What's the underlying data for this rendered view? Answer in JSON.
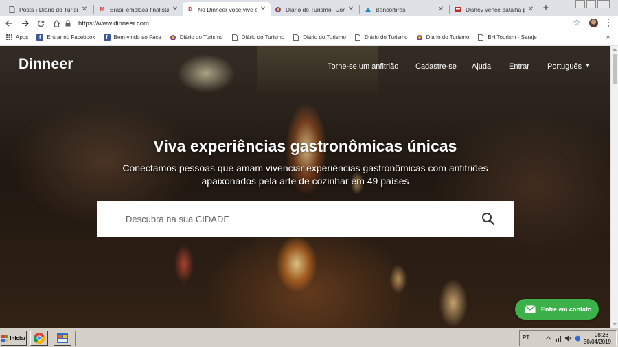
{
  "browser": {
    "tabs": [
      {
        "title": "Posts ‹ Diário do Turismo",
        "favicon": "page-icon",
        "active": false
      },
      {
        "title": "Brasil emplaca finalista e",
        "favicon": "gmail-icon",
        "active": false
      },
      {
        "title": "No Dinneer você vive ex",
        "favicon": "dinneer-icon",
        "active": true
      },
      {
        "title": "Diário do Turismo - Jorn",
        "favicon": "diario-icon",
        "active": false
      },
      {
        "title": "Bancorbrás",
        "favicon": "bancorbras-icon",
        "active": false
      },
      {
        "title": "Disney vence batalha pe",
        "favicon": "news-icon",
        "active": false
      }
    ],
    "new_tab_label": "+",
    "url": "https://www.dinneer.com",
    "bookmarks": [
      {
        "label": "Apps",
        "icon": "apps-grid-icon"
      },
      {
        "label": "Entrar no Facebook",
        "icon": "facebook-icon"
      },
      {
        "label": "Bem-vindo ao Face",
        "icon": "facebook-icon"
      },
      {
        "label": "Diário do Turismo",
        "icon": "diario-icon"
      },
      {
        "label": "Diário do Turismo",
        "icon": "page-icon"
      },
      {
        "label": "Diário do Turismo",
        "icon": "page-icon"
      },
      {
        "label": "Diário do Turismo",
        "icon": "page-icon"
      },
      {
        "label": "Diário do Turismo",
        "icon": "diario-icon"
      },
      {
        "label": "BH Tourism - Saraje",
        "icon": "page-icon"
      }
    ],
    "bookmarks_more": "»"
  },
  "site": {
    "brand": "Dinneer",
    "nav": {
      "host": "Torne-se um anfitrião",
      "signup": "Cadastre-se",
      "help": "Ajuda",
      "login": "Entrar",
      "language": "Português"
    },
    "hero": {
      "title": "Viva experiências gastronômicas únicas",
      "subtitle": "Conectamos pessoas que amam vivenciar experiências gastronômicas com anfitriões apaixonados pela arte de cozinhar em 49 países"
    },
    "search": {
      "placeholder": "Descubra na sua CIDADE"
    },
    "contact_button": "Entre em contato",
    "colors": {
      "contact_green": "#3cb14a"
    }
  },
  "taskbar": {
    "start_label": "Iniciar",
    "language": "PT",
    "time": "08:28",
    "date": "30/04/2019"
  }
}
